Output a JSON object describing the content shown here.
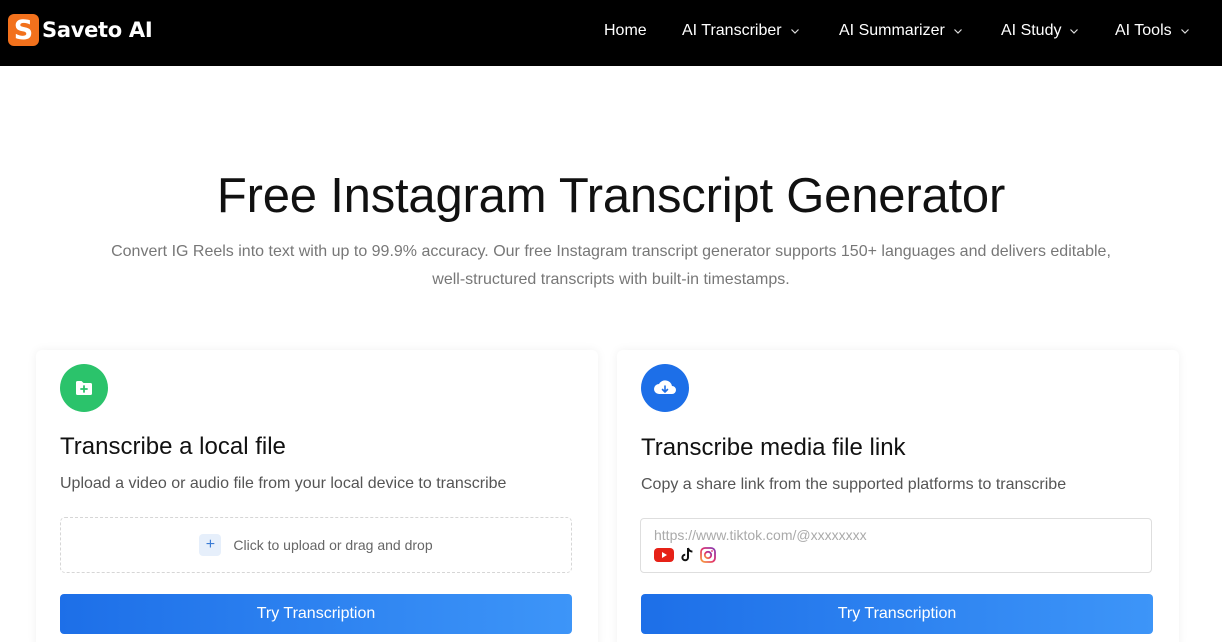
{
  "brand": {
    "logo_letter": "S",
    "name": "Saveto AI"
  },
  "nav": {
    "home": "Home",
    "transcriber": "AI Transcriber",
    "summarizer": "AI Summarizer",
    "study": "AI Study",
    "tools": "AI Tools"
  },
  "hero": {
    "title": "Free Instagram Transcript Generator",
    "subtitle": "Convert IG Reels into text with up to 99.9% accuracy. Our free Instagram transcript generator supports 150+ languages and delivers editable, well-structured transcripts with built-in timestamps."
  },
  "local_card": {
    "title": "Transcribe a local file",
    "description": "Upload a video or audio file from your local device to transcribe",
    "dropzone_text": "Click to upload or drag and drop",
    "button": "Try Transcription",
    "icon": "file-add-icon"
  },
  "link_card": {
    "title": "Transcribe media file link",
    "description": "Copy a share link from the supported platforms to transcribe",
    "placeholder": "https://www.tiktok.com/@xxxxxxxx",
    "value": "",
    "platforms": [
      "youtube-icon",
      "tiktok-icon",
      "instagram-icon"
    ],
    "button": "Try Transcription",
    "icon": "cloud-download-icon"
  },
  "colors": {
    "accent_blue": "#1d6fe8",
    "green": "#2bc36b",
    "brand_orange": "#f2711c",
    "header_bg": "#000000"
  }
}
